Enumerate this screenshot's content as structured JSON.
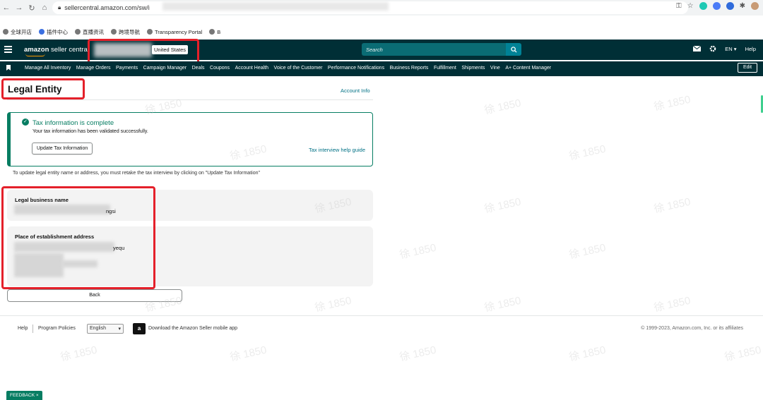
{
  "browser": {
    "url": "sellercentral.amazon.com/sw/i",
    "bookmarks": [
      "全球开店",
      "插件中心",
      "直播资讯",
      "跨境导航",
      "Transparency Portal",
      "B"
    ]
  },
  "topnav": {
    "logo_brand": "amazon",
    "logo_suffix": " seller central",
    "marketplace": "United States",
    "search_placeholder": "Search",
    "language": "EN ▾",
    "help": "Help"
  },
  "menu": {
    "items": [
      "Manage All Inventory",
      "Manage Orders",
      "Payments",
      "Campaign Manager",
      "Deals",
      "Coupons",
      "Account Health",
      "Voice of the Customer",
      "Performance Notifications",
      "Business Reports",
      "Fulfillment",
      "Shipments",
      "Vine",
      "A+ Content Manager"
    ],
    "edit": "Edit"
  },
  "main": {
    "page_title": "Legal Entity",
    "account_info": "Account Info",
    "tax_card": {
      "title": "Tax information is complete",
      "subtitle": "Your tax information has been validated successfully.",
      "update_button": "Update Tax Information",
      "help_link": "Tax interview help guide"
    },
    "retake_note": "To update legal entity name or address, you must retake the tax interview by clicking on \"Update Tax Information\"",
    "legal_name": {
      "label": "Legal business name",
      "partial_value": "ngsi"
    },
    "address": {
      "label": "Place of establishment address",
      "partial_value": "yequ"
    },
    "back_button": "Back"
  },
  "footer": {
    "help": "Help",
    "program_policies": "Program Policies",
    "language_select": "English",
    "app_text": "Download the Amazon Seller mobile app",
    "copyright": "© 1999-2023, Amazon.com, Inc. or its affiliates"
  },
  "feedback": "FEEDBACK ×",
  "watermark_text": "徐 1850",
  "colors": {
    "nav_bg": "#002f36",
    "success": "#067d62",
    "link": "#007185",
    "highlight": "#e4202a"
  }
}
